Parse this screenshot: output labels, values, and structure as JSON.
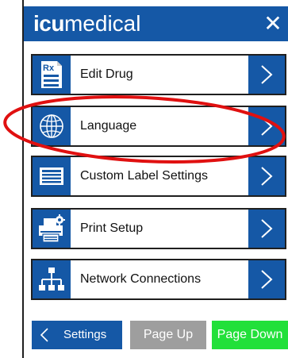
{
  "header": {
    "logo_bold": "icu",
    "logo_light": "medical",
    "close_symbol": "✕"
  },
  "menu": {
    "items": [
      {
        "label": "Edit Drug",
        "icon": "prescription-document-icon"
      },
      {
        "label": "Language",
        "icon": "globe-icon",
        "highlighted": true
      },
      {
        "label": "Custom Label Settings",
        "icon": "label-card-icon"
      },
      {
        "label": "Print Setup",
        "icon": "printer-gear-icon"
      },
      {
        "label": "Network Connections",
        "icon": "network-tree-icon"
      }
    ]
  },
  "footer": {
    "back_label": "Settings",
    "page_up_label": "Page Up",
    "page_down_label": "Page Down"
  },
  "colors": {
    "brand_blue": "#1558a6",
    "disabled_gray": "#9e9e9e",
    "page_down_green": "#22e03a",
    "highlight_red": "#e01010"
  }
}
